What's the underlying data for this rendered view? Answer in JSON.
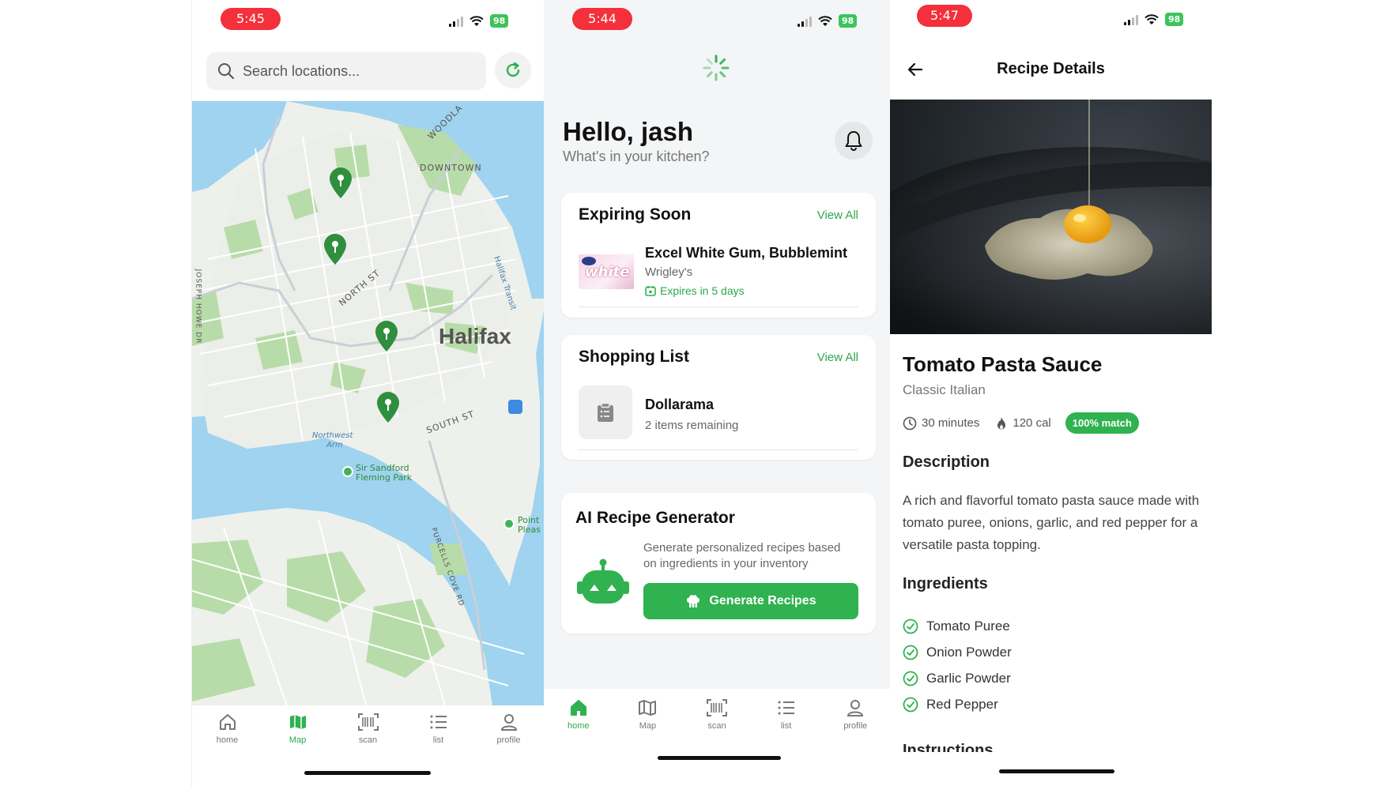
{
  "colors": {
    "accent": "#2fb24f",
    "time_pill": "#f3303b",
    "battery": "#3cc45a"
  },
  "map_screen": {
    "status": {
      "time": "5:45",
      "battery": "98"
    },
    "search": {
      "placeholder": "Search locations..."
    },
    "map": {
      "city": "Halifax",
      "labels": {
        "downtown": "DOWNTOWN",
        "woodlawn": "WOODLA",
        "north_st": "NORTH ST",
        "south_st": "SOUTH ST",
        "joseph_howe": "JOSEPH HOWE DR",
        "halifax_transit": "Halifax Transit",
        "northwest_arm_1": "Northwest",
        "northwest_arm_2": "Arm",
        "park_1": "Sir Sandford",
        "park_2": "Fleming Park",
        "point_1": "Point",
        "point_2": "Pleas",
        "purcells": "PURCELLS COVE RD"
      }
    },
    "tabs": [
      {
        "label": "home",
        "icon": "home-icon"
      },
      {
        "label": "Map",
        "icon": "map-icon"
      },
      {
        "label": "scan",
        "icon": "barcode-icon"
      },
      {
        "label": "list",
        "icon": "list-icon"
      },
      {
        "label": "profile",
        "icon": "profile-icon"
      }
    ]
  },
  "home_screen": {
    "status": {
      "time": "5:44",
      "battery": "98"
    },
    "greeting": "Hello, jash",
    "subtitle": "What's in your kitchen?",
    "expiring": {
      "title": "Expiring Soon",
      "view_all": "View All",
      "item": {
        "name": "Excel White Gum, Bubblemint",
        "brand": "Wrigley's",
        "expires": "Expires in 5 days",
        "thumb_text": "white"
      }
    },
    "shopping": {
      "title": "Shopping List",
      "view_all": "View All",
      "item": {
        "name": "Dollarama",
        "remaining": "2 items remaining"
      }
    },
    "ai": {
      "title": "AI Recipe Generator",
      "description": "Generate personalized recipes based on ingredients in your inventory",
      "button": "Generate Recipes"
    },
    "tabs": [
      {
        "label": "home",
        "icon": "home-icon"
      },
      {
        "label": "Map",
        "icon": "map-icon"
      },
      {
        "label": "scan",
        "icon": "barcode-icon"
      },
      {
        "label": "list",
        "icon": "list-icon"
      },
      {
        "label": "profile",
        "icon": "profile-icon"
      }
    ]
  },
  "recipe_screen": {
    "status": {
      "time": "5:47",
      "battery": "98"
    },
    "nav_title": "Recipe Details",
    "title": "Tomato Pasta Sauce",
    "cuisine": "Classic Italian",
    "time": "30 minutes",
    "calories": "120 cal",
    "match": "100% match",
    "description_title": "Description",
    "description": "A rich and flavorful tomato pasta sauce made with tomato puree, onions, garlic, and red pepper for a versatile pasta topping.",
    "ingredients_title": "Ingredients",
    "ingredients": [
      "Tomato Puree",
      "Onion Powder",
      "Garlic Powder",
      "Red Pepper"
    ],
    "instructions_title": "Instructions"
  }
}
